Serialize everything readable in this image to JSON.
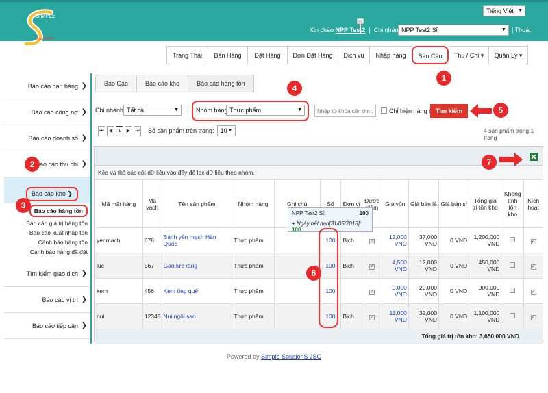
{
  "header": {
    "language": "Tiếng Việt",
    "greeting": "Xin chào",
    "user": "NPP Test2",
    "branch_label": "Chi nhánh:",
    "branch": "NPP Test2 Sỉ",
    "logout": "Thoát",
    "logo_text_top": "SIMPLE",
    "logo_text_bottom": "SmartSales"
  },
  "nav": {
    "tabs": [
      {
        "label": "Trang Thái"
      },
      {
        "label": "Bán Hàng"
      },
      {
        "label": "Đặt Hàng"
      },
      {
        "label": "Đơn Đặt Hàng"
      },
      {
        "label": "Dịch vụ"
      },
      {
        "label": "Nhập hàng"
      },
      {
        "label": "Báo Cáo"
      },
      {
        "label": "Thu / Chi"
      },
      {
        "label": "Quản Lý"
      }
    ]
  },
  "sidebar": {
    "items": [
      {
        "label": "Báo cáo bán hàng"
      },
      {
        "label": "Báo cáo công nợ"
      },
      {
        "label": "Báo cáo doanh số"
      },
      {
        "label": "Báo cáo thu chi"
      },
      {
        "label": "Báo cáo kho"
      },
      {
        "label": "Tìm kiếm giao dịch"
      },
      {
        "label": "Báo cáo vị trí"
      },
      {
        "label": "Báo cáo tiếp cận"
      }
    ],
    "sub_items": [
      {
        "label": "Báo cáo hàng tồn"
      },
      {
        "label": "Báo cáo giá trị hàng tồn"
      },
      {
        "label": "Báo cáo xuất nhập tồn"
      },
      {
        "label": "Cảnh báo hàng tồn"
      },
      {
        "label": "Cảnh báo hàng đã đặt"
      }
    ]
  },
  "breadcrumb": [
    "Báo Cáo",
    "Báo cáo kho",
    "Báo cáo hàng tồn"
  ],
  "filters": {
    "branch_label": "Chi nhánh:",
    "branch_value": "Tất cả",
    "group_label": "Nhóm hàng:",
    "group_value": "Thực phẩm",
    "search_placeholder": "Nhập từ khóa cần tìm ...",
    "only_stock_label": "Chỉ hiện hàng tồn",
    "search_button": "Tìm kiếm",
    "page_size_label": "Số sản phẩm trên trang:",
    "page_size": "10",
    "current_page": "1",
    "count_text": "4 sản phẩm trong 1 trang"
  },
  "grid": {
    "group_hint": "Kéo và thả các cột dữ liệu vào đây để lọc dữ liệu theo nhóm.",
    "columns": [
      "Mã mặt hàng",
      "Mã vạch",
      "Tên sản phẩm",
      "Nhóm hàng",
      "Ghi chú",
      "Số",
      "Đơn vị",
      "Được giảm",
      "Giá vốn",
      "Giá bán lẻ",
      "Giá bán sỉ",
      "Tổng giá trị tồn kho",
      "Không tính tồn kho",
      "Kích hoạt"
    ],
    "rows": [
      {
        "code": "yenmach",
        "barcode": "678",
        "name": "Bánh yến mạch Hàn Quốc",
        "group": "Thực phẩm",
        "qty": "100",
        "unit": "Bịch",
        "cost": "12,000 VND",
        "retail": "37,000 VND",
        "wholesale": "0 VND",
        "total": "1,200,000 VND"
      },
      {
        "code": "luc",
        "barcode": "567",
        "name": "Gạo lức rang",
        "group": "Thực phẩm",
        "qty": "100",
        "unit": "Bịch",
        "cost": "4,500 VND",
        "retail": "12,000 VND",
        "wholesale": "0 VND",
        "total": "450,000 VND"
      },
      {
        "code": "kem",
        "barcode": "456",
        "name": "Kem ống quế",
        "group": "Thực phẩm",
        "qty": "100",
        "unit": "",
        "cost": "9,000 VND",
        "retail": "20,000 VND",
        "wholesale": "0 VND",
        "total": "900,000 VND"
      },
      {
        "code": "nui",
        "barcode": "12345",
        "name": "Nui ngôi sao",
        "group": "Thực phẩm",
        "qty": "100",
        "unit": "Bịch",
        "cost": "11,000 VND",
        "retail": "32,000 VND",
        "wholesale": "0 VND",
        "total": "1,100,000 VND"
      }
    ],
    "total_text": "Tổng giá trị tồn kho: 3,650,000 VND"
  },
  "tooltip": {
    "branch": "NPP Test2 Sỉ:",
    "value": "100",
    "expiry_prefix": "+ Ngày hết hạn[31/05/2018]:",
    "expiry_value": "100"
  },
  "footer": {
    "prefix": "Powered by",
    "brand": "Simple SolutionS JSC"
  },
  "callouts": [
    "1",
    "2",
    "3",
    "4",
    "5",
    "6",
    "7"
  ],
  "colors": {
    "header": "#2aa8a0",
    "accent": "#e33333",
    "button": "#d9352a",
    "link": "#1a3fb8"
  }
}
